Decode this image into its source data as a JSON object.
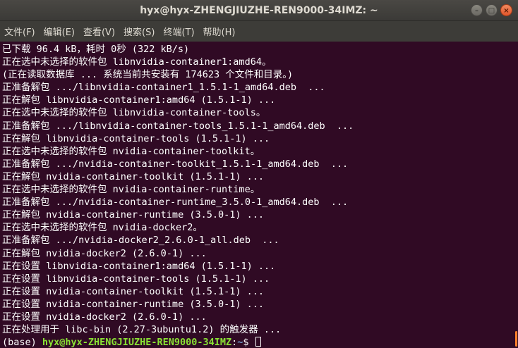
{
  "window": {
    "title": "hyx@hyx-ZHENGJIUZHE-REN9000-34IMZ: ~",
    "controls": [
      "minimize-icon",
      "maximize-icon",
      "close-icon"
    ]
  },
  "menu": [
    "文件(F)",
    "编辑(E)",
    "查看(V)",
    "搜索(S)",
    "终端(T)",
    "帮助(H)"
  ],
  "terminal": {
    "lines": [
      "已下载 96.4 kB，耗时 0秒 (322 kB/s)",
      "正在选中未选择的软件包 libnvidia-container1:amd64。",
      "(正在读取数据库 ... 系统当前共安装有 174623 个文件和目录。)",
      "正准备解包 .../libnvidia-container1_1.5.1-1_amd64.deb  ...",
      "正在解包 libnvidia-container1:amd64 (1.5.1-1) ...",
      "正在选中未选择的软件包 libnvidia-container-tools。",
      "正准备解包 .../libnvidia-container-tools_1.5.1-1_amd64.deb  ...",
      "正在解包 libnvidia-container-tools (1.5.1-1) ...",
      "正在选中未选择的软件包 nvidia-container-toolkit。",
      "正准备解包 .../nvidia-container-toolkit_1.5.1-1_amd64.deb  ...",
      "正在解包 nvidia-container-toolkit (1.5.1-1) ...",
      "正在选中未选择的软件包 nvidia-container-runtime。",
      "正准备解包 .../nvidia-container-runtime_3.5.0-1_amd64.deb  ...",
      "正在解包 nvidia-container-runtime (3.5.0-1) ...",
      "正在选中未选择的软件包 nvidia-docker2。",
      "正准备解包 .../nvidia-docker2_2.6.0-1_all.deb  ...",
      "正在解包 nvidia-docker2 (2.6.0-1) ...",
      "正在设置 libnvidia-container1:amd64 (1.5.1-1) ...",
      "正在设置 libnvidia-container-tools (1.5.1-1) ...",
      "正在设置 nvidia-container-toolkit (1.5.1-1) ...",
      "正在设置 nvidia-container-runtime (3.5.0-1) ...",
      "正在设置 nvidia-docker2 (2.6.0-1) ...",
      "正在处理用于 libc-bin (2.27-3ubuntu1.2) 的触发器 ..."
    ],
    "prompt": {
      "env": "(base) ",
      "user_host": "hyx@hyx-ZHENGJIUZHE-REN9000-34IMZ",
      "sep": ":",
      "path": "~",
      "symbol": "$ "
    }
  },
  "colors": {
    "terminal_bg": "#300a24",
    "prompt_user": "#8ae234",
    "prompt_path": "#729fcf",
    "scroll_thumb": "#ff7f2a"
  }
}
